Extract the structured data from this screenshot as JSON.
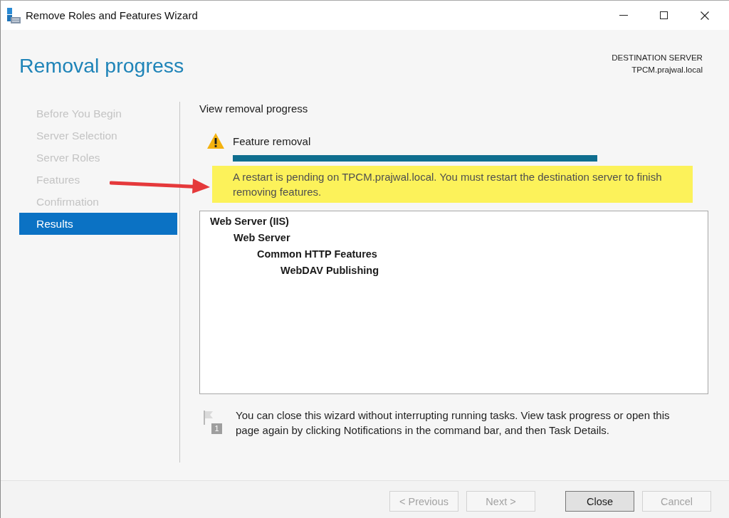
{
  "window": {
    "title": "Remove Roles and Features Wizard"
  },
  "header": {
    "title": "Removal progress",
    "server_label": "DESTINATION SERVER",
    "server_name": "TPCM.prajwal.local"
  },
  "steps": [
    {
      "label": "Before You Begin",
      "selected": false
    },
    {
      "label": "Server Selection",
      "selected": false
    },
    {
      "label": "Server Roles",
      "selected": false
    },
    {
      "label": "Features",
      "selected": false
    },
    {
      "label": "Confirmation",
      "selected": false
    },
    {
      "label": "Results",
      "selected": true
    }
  ],
  "progress": {
    "heading": "View removal progress",
    "task": {
      "label": "Feature removal",
      "warning": true,
      "level": 1
    },
    "message": {
      "text": "A restart is pending on TPCM.prajwal.local. You must restart the destination server to finish removing features.",
      "highlighted": true
    },
    "annotation": {
      "kind": "arrow"
    }
  },
  "tree": [
    {
      "label": "Web Server (IIS)",
      "children": [
        {
          "label": "Web Server",
          "children": [
            {
              "label": "Common HTTP Features",
              "children": [
                {
                  "label": "WebDAV Publishing"
                }
              ]
            }
          ]
        }
      ]
    }
  ],
  "note": {
    "text": "You can close this wizard without interrupting running tasks. View task progress or open this page again by clicking Notifications in the command bar, and then Task Details.",
    "badge": "1"
  },
  "navigation": [
    {
      "label": "< Previous",
      "disabled": true
    },
    {
      "label": "Next >",
      "disabled": true
    }
  ],
  "actions": [
    {
      "label": "Close",
      "disabled": false,
      "default": true
    },
    {
      "label": "Cancel",
      "disabled": true,
      "default": false
    }
  ]
}
